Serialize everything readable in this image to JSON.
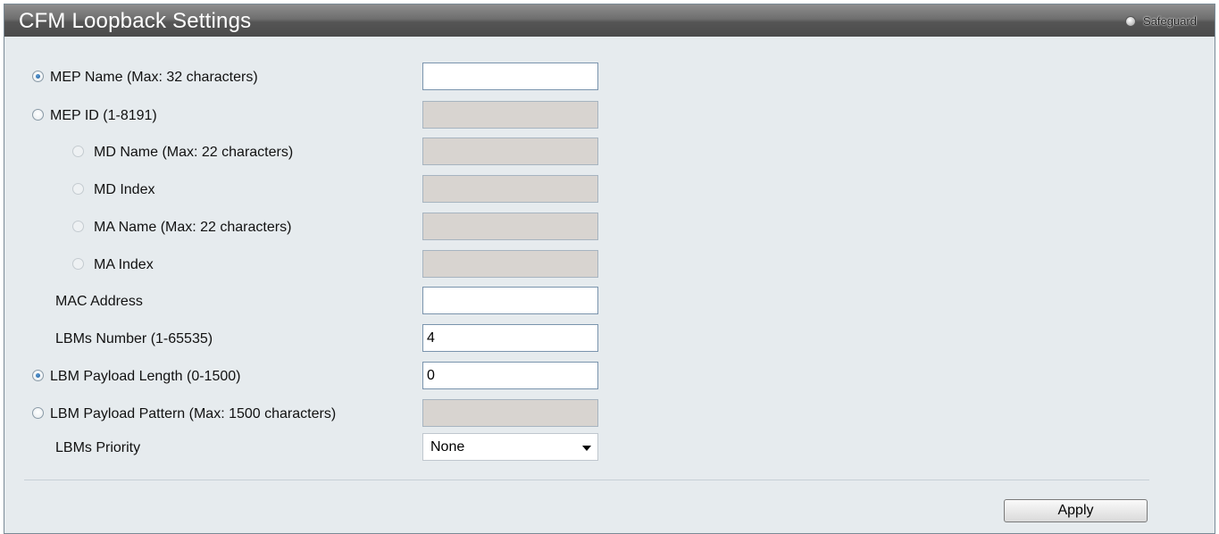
{
  "header": {
    "title": "CFM Loopback Settings",
    "safeguard_label": "Safeguard"
  },
  "form": {
    "mep_name": {
      "label": "MEP Name (Max: 32 characters)",
      "value": "",
      "selected": true
    },
    "mep_id": {
      "label": "MEP ID (1-8191)",
      "value": "",
      "selected": false
    },
    "md_name": {
      "label": "MD Name (Max: 22 characters)",
      "value": ""
    },
    "md_index": {
      "label": "MD Index",
      "value": ""
    },
    "ma_name": {
      "label": "MA Name (Max: 22 characters)",
      "value": ""
    },
    "ma_index": {
      "label": "MA Index",
      "value": ""
    },
    "mac_address": {
      "label": "MAC Address",
      "value": ""
    },
    "lbms_number": {
      "label": "LBMs Number (1-65535)",
      "value": "4"
    },
    "lbm_payload_length": {
      "label": "LBM Payload Length (0-1500)",
      "value": "0",
      "selected": true
    },
    "lbm_payload_pattern": {
      "label": "LBM Payload Pattern (Max: 1500 characters)",
      "value": "",
      "selected": false
    },
    "lbms_priority": {
      "label": "LBMs Priority",
      "value": "None"
    }
  },
  "actions": {
    "apply_label": "Apply"
  }
}
